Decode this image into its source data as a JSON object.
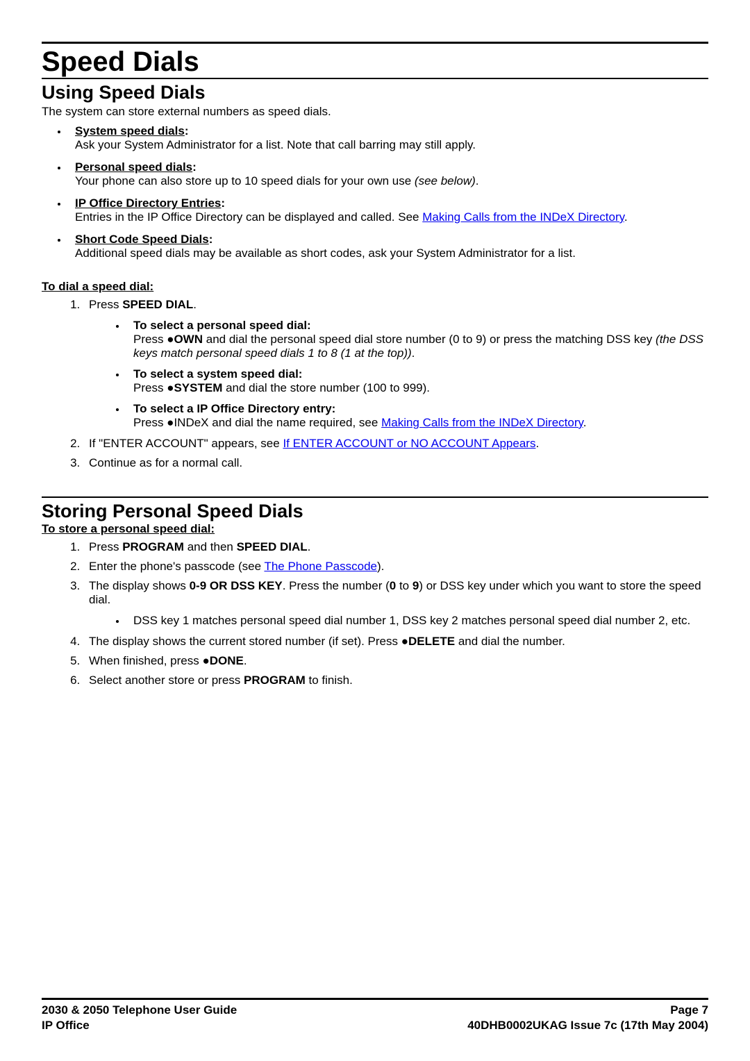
{
  "h1": "Speed Dials",
  "sec1": {
    "title": "Using Speed Dials",
    "intro": "The system can store external numbers as speed dials.",
    "items": [
      {
        "label": "System speed dials",
        "desc": "Ask your System Administrator for a list. Note that call barring may still apply."
      },
      {
        "label": "Personal speed dials",
        "desc_pre": "Your phone can also store up to 10 speed dials for your own use ",
        "desc_italic": "(see below)",
        "desc_post": "."
      },
      {
        "label": "IP Office Directory Entries",
        "desc_pre": "Entries in the IP Office Directory can be displayed and called. See ",
        "link": "Making Calls from the INDeX Directory",
        "desc_post": "."
      },
      {
        "label": "Short Code Speed Dials",
        "desc": "Additional speed dials may be available as short codes, ask your System Administrator for a list."
      }
    ],
    "to_dial": "To dial a speed dial:",
    "step1_pre": "Press ",
    "step1_bold": "SPEED DIAL",
    "step1_post": ".",
    "sub": [
      {
        "title": "To select a personal speed dial:",
        "line_pre": "Press ",
        "line_bold": "●OWN",
        "line_mid": " and dial the personal speed dial store number (0 to 9) or press the matching DSS key ",
        "line_italic": "(the DSS keys match personal speed dials 1 to 8 (1 at the top))",
        "line_post": "."
      },
      {
        "title": "To select a system speed dial:",
        "line_pre": "Press ",
        "line_bold": "●SYSTEM",
        "line_mid": " and dial the store number (100 to 999)."
      },
      {
        "title": "To select a IP Office Directory entry:",
        "line_pre": "Press ●INDeX and dial the name required, see ",
        "link": "Making Calls from the INDeX Directory",
        "line_post": "."
      }
    ],
    "step2_pre": "If \"ENTER ACCOUNT\" appears, see ",
    "step2_link": "If ENTER ACCOUNT or NO ACCOUNT Appears",
    "step2_post": ".",
    "step3": "Continue as for a normal call."
  },
  "sec2": {
    "title": "Storing Personal Speed Dials",
    "to_store": "To store a personal speed dial:",
    "s1_pre": "Press ",
    "s1_b1": "PROGRAM",
    "s1_mid": " and then ",
    "s1_b2": "SPEED DIAL",
    "s1_post": ".",
    "s2_pre": "Enter the phone's passcode (see ",
    "s2_link": "The Phone Passcode",
    "s2_post": ").",
    "s3_pre": "The display shows ",
    "s3_b1": "0-9 OR DSS KEY",
    "s3_mid1": ". Press the number (",
    "s3_b2": "0",
    "s3_mid2": " to ",
    "s3_b3": "9",
    "s3_post": ") or DSS key under which you want to store the speed dial.",
    "s3_sub": "DSS key 1 matches personal speed dial number 1, DSS key 2 matches personal speed dial number 2, etc.",
    "s4_pre": "The display shows the current stored number (if set). Press ",
    "s4_b": "●DELETE",
    "s4_post": " and dial the number.",
    "s5_pre": "When finished, press ",
    "s5_b": "●DONE",
    "s5_post": ".",
    "s6_pre": "Select another store or press ",
    "s6_b": "PROGRAM",
    "s6_post": " to finish."
  },
  "footer": {
    "left1": "2030 & 2050 Telephone User Guide",
    "right1": "Page 7",
    "left2": "IP Office",
    "right2": "40DHB0002UKAG Issue 7c (17th May 2004)"
  }
}
